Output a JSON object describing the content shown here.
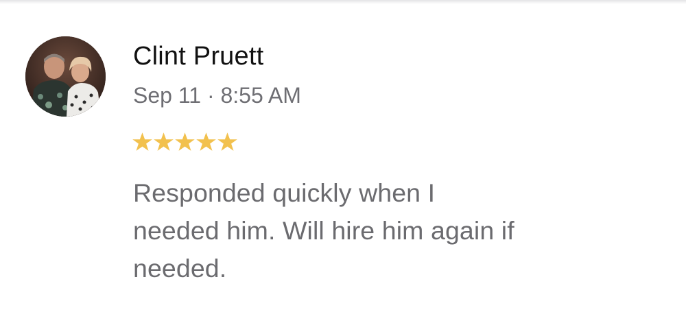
{
  "review": {
    "reviewer_name": "Clint Pruett",
    "date": "Sep 11",
    "separator": "·",
    "time": "8:55 AM",
    "rating": 5,
    "rating_max": 5,
    "star_color": "#F2C14E",
    "text_lines": [
      "Responded quickly when I",
      "needed him. Will hire him again if",
      "needed."
    ]
  }
}
